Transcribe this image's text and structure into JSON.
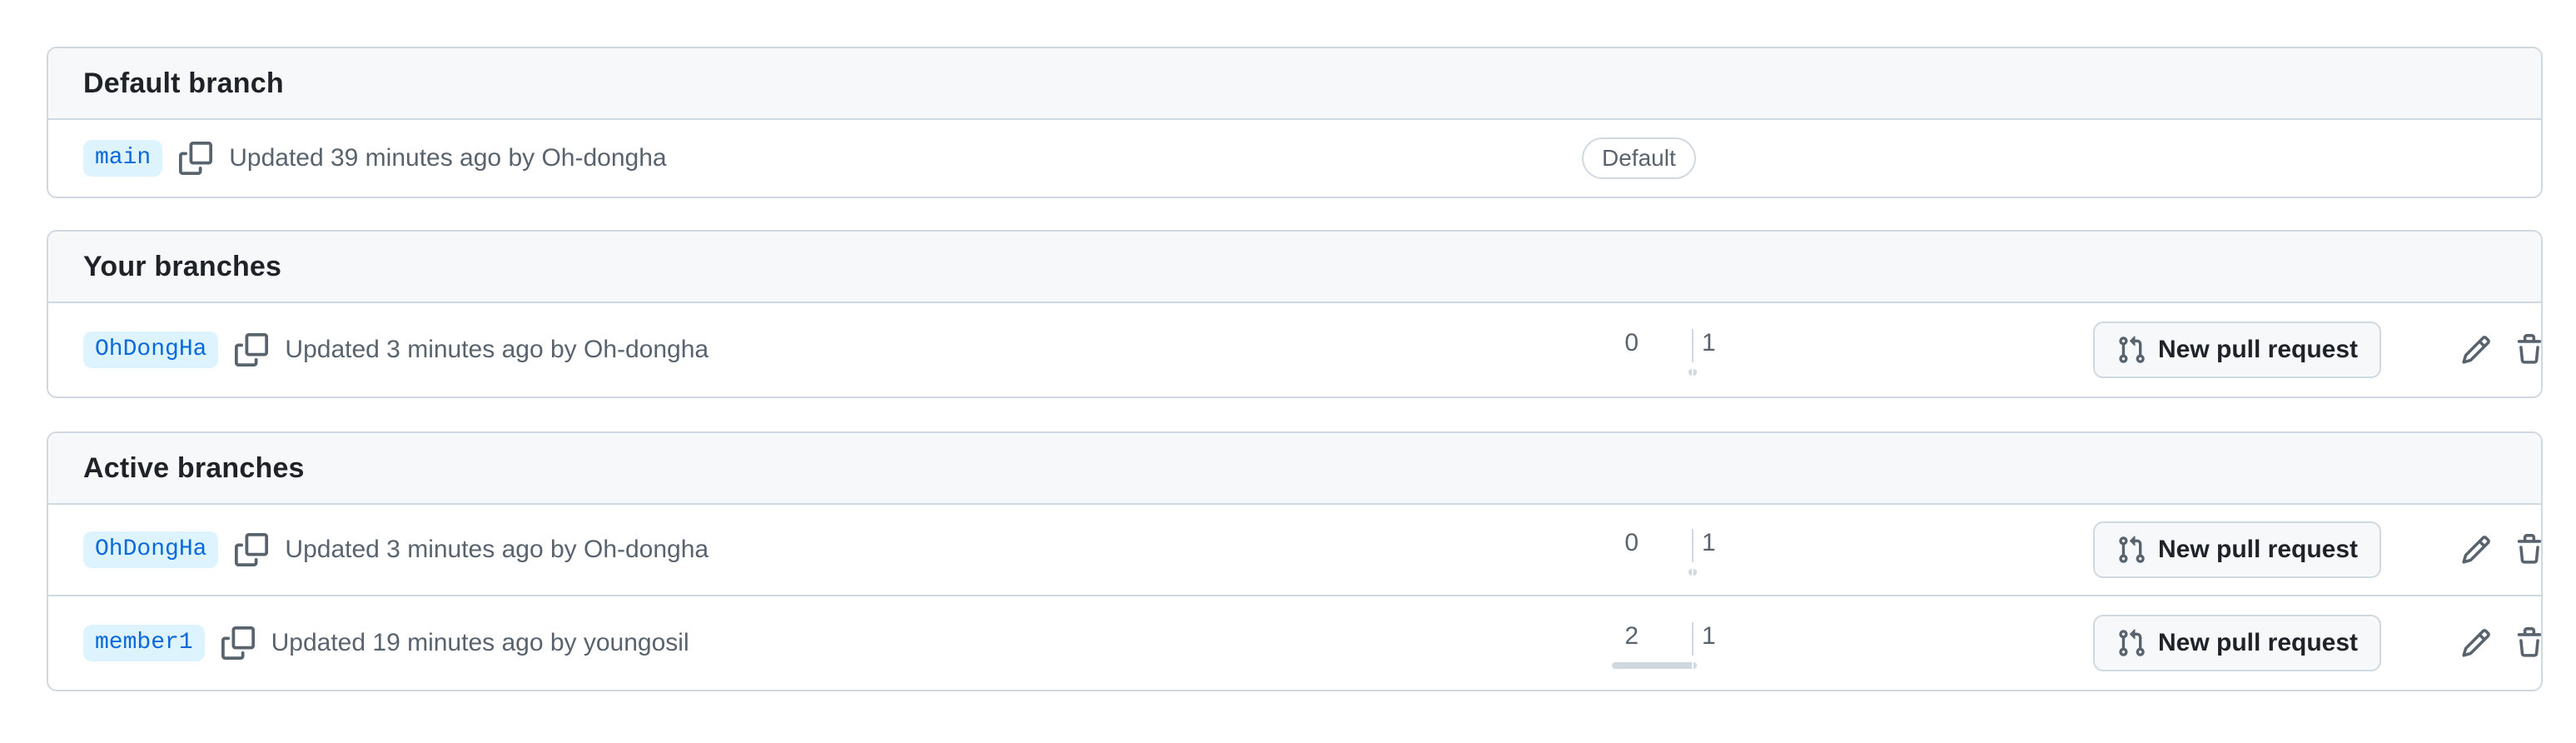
{
  "sections": {
    "default": {
      "title": "Default branch",
      "branch": "main",
      "updated": "Updated 39 minutes ago by Oh-dongha",
      "badge": "Default"
    },
    "yours": {
      "title": "Your branches",
      "rows": [
        {
          "branch": "OhDongHa",
          "updated": "Updated 3 minutes ago by Oh-dongha",
          "behind": "0",
          "ahead": "1",
          "behind_value": 0,
          "ahead_value": 1,
          "pr_label": "New pull request"
        }
      ]
    },
    "active": {
      "title": "Active branches",
      "rows": [
        {
          "branch": "OhDongHa",
          "updated": "Updated 3 minutes ago by Oh-dongha",
          "behind": "0",
          "ahead": "1",
          "behind_value": 0,
          "ahead_value": 1,
          "pr_label": "New pull request"
        },
        {
          "branch": "member1",
          "updated": "Updated 19 minutes ago by youngosil",
          "behind": "2",
          "ahead": "1",
          "behind_value": 2,
          "ahead_value": 1,
          "pr_label": "New pull request"
        }
      ]
    }
  },
  "icons": {
    "copy": "copy-icon",
    "pull_request": "git-pull-request-icon",
    "edit": "pencil-icon",
    "delete": "trash-icon"
  },
  "colors": {
    "branch_bg": "#ddf4ff",
    "branch_text": "#0969da",
    "border": "#d1d9e0",
    "header_bg": "#f6f8fa",
    "muted_text": "#59636e"
  }
}
